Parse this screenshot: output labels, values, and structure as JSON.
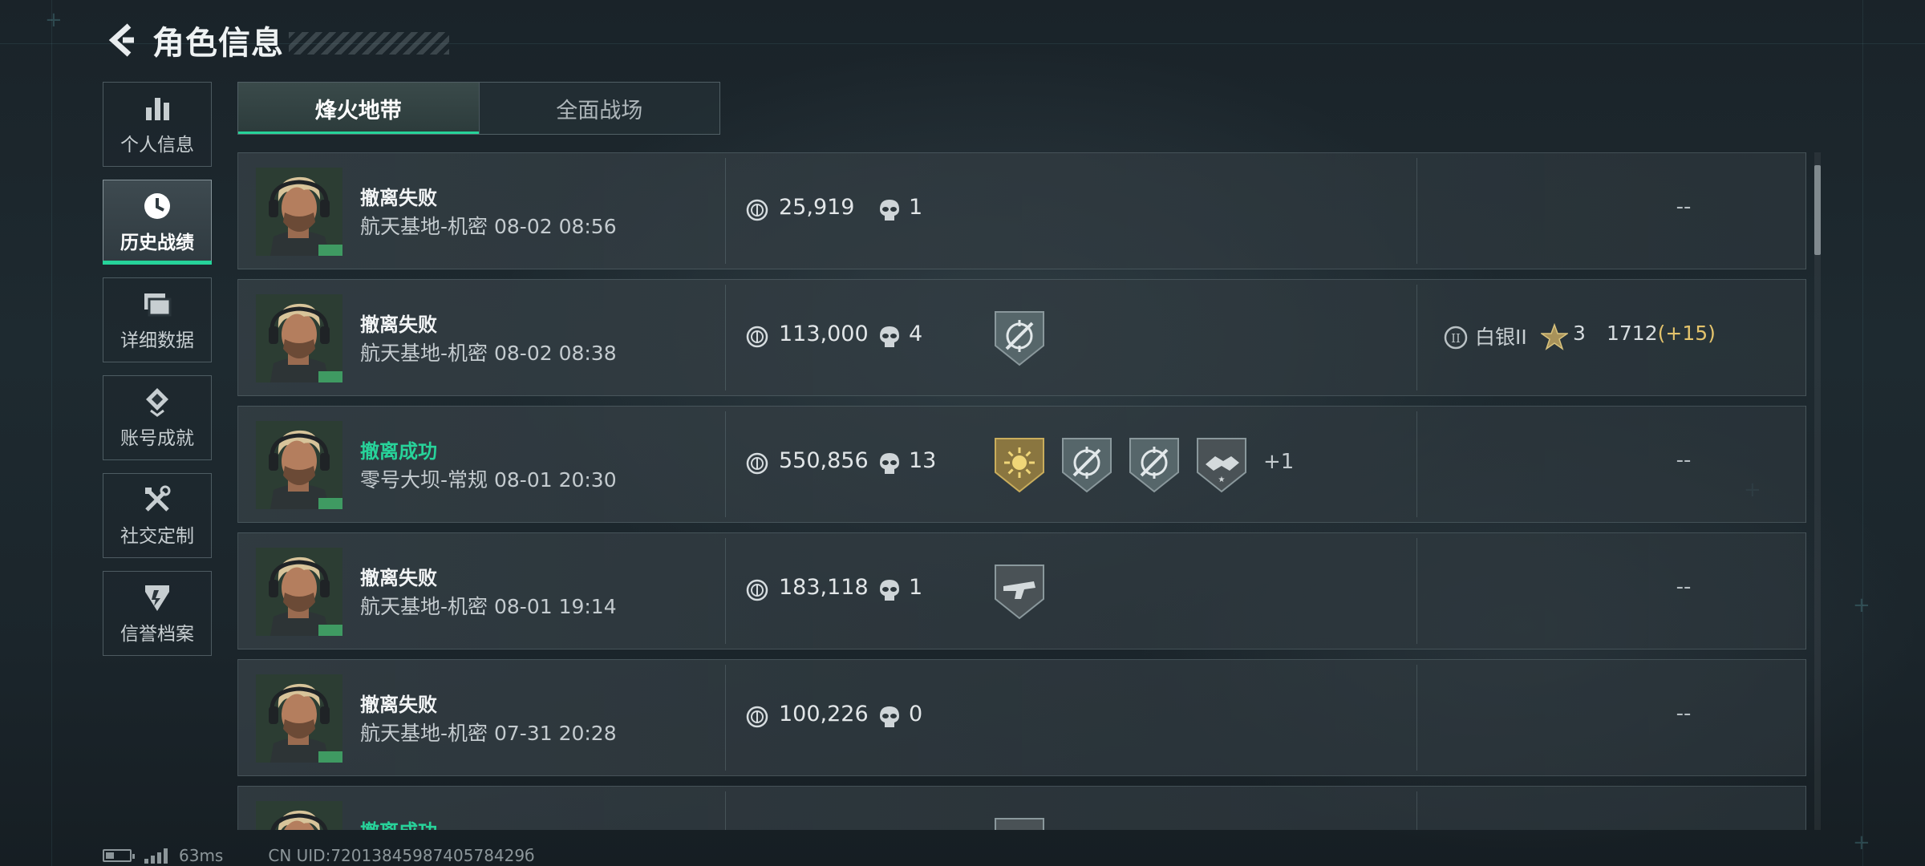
{
  "header": {
    "title": "角色信息"
  },
  "sidenav": [
    {
      "label": "个人信息",
      "icon": "bar-chart-icon",
      "active": false
    },
    {
      "label": "历史战绩",
      "icon": "clock-icon",
      "active": true
    },
    {
      "label": "详细数据",
      "icon": "folders-icon",
      "active": false
    },
    {
      "label": "账号成就",
      "icon": "medal-icon",
      "active": false
    },
    {
      "label": "社交定制",
      "icon": "tools-icon",
      "active": false
    },
    {
      "label": "信誉档案",
      "icon": "shield-icon",
      "active": false
    }
  ],
  "tabs": [
    {
      "label": "烽火地带",
      "active": true
    },
    {
      "label": "全面战场",
      "active": false
    }
  ],
  "records": [
    {
      "result": "撤离失败",
      "success": false,
      "map": "航天基地-机密",
      "time": "08-02 08:56",
      "value": "25,919",
      "kills": "1",
      "badges": [],
      "more": "",
      "right": "--"
    },
    {
      "result": "撤离失败",
      "success": false,
      "map": "航天基地-机密",
      "time": "08-02 08:38",
      "value": "113,000",
      "kills": "4",
      "badges": [
        "crosshair-badge"
      ],
      "more": "",
      "right": "",
      "rank": {
        "name": "白银II",
        "stars": "3",
        "score": "1712",
        "delta": "(+15)"
      }
    },
    {
      "result": "撤离成功",
      "success": true,
      "map": "零号大坝-常规",
      "time": "08-01 20:30",
      "value": "550,856",
      "kills": "13",
      "badges": [
        "gold-sun-badge",
        "rifle-badge",
        "crosshair-badge",
        "handshake-badge"
      ],
      "more": "+1",
      "right": "--"
    },
    {
      "result": "撤离失败",
      "success": false,
      "map": "航天基地-机密",
      "time": "08-01 19:14",
      "value": "183,118",
      "kills": "1",
      "badges": [
        "gun-badge"
      ],
      "more": "",
      "right": "--"
    },
    {
      "result": "撤离失败",
      "success": false,
      "map": "航天基地-机密",
      "time": "07-31 20:28",
      "value": "100,226",
      "kills": "0",
      "badges": [],
      "more": "",
      "right": "--"
    },
    {
      "result": "撤离成功",
      "success": true,
      "map": "",
      "time": "",
      "value": "",
      "kills": "",
      "badges": [
        "gun-badge"
      ],
      "more": "",
      "right": ""
    }
  ],
  "status": {
    "ping": "63ms",
    "uid": "CN UID:7201384598740578429б"
  },
  "colors": {
    "accent": "#26d39a",
    "success": "#27d39a",
    "delta": "#e3c36c"
  }
}
